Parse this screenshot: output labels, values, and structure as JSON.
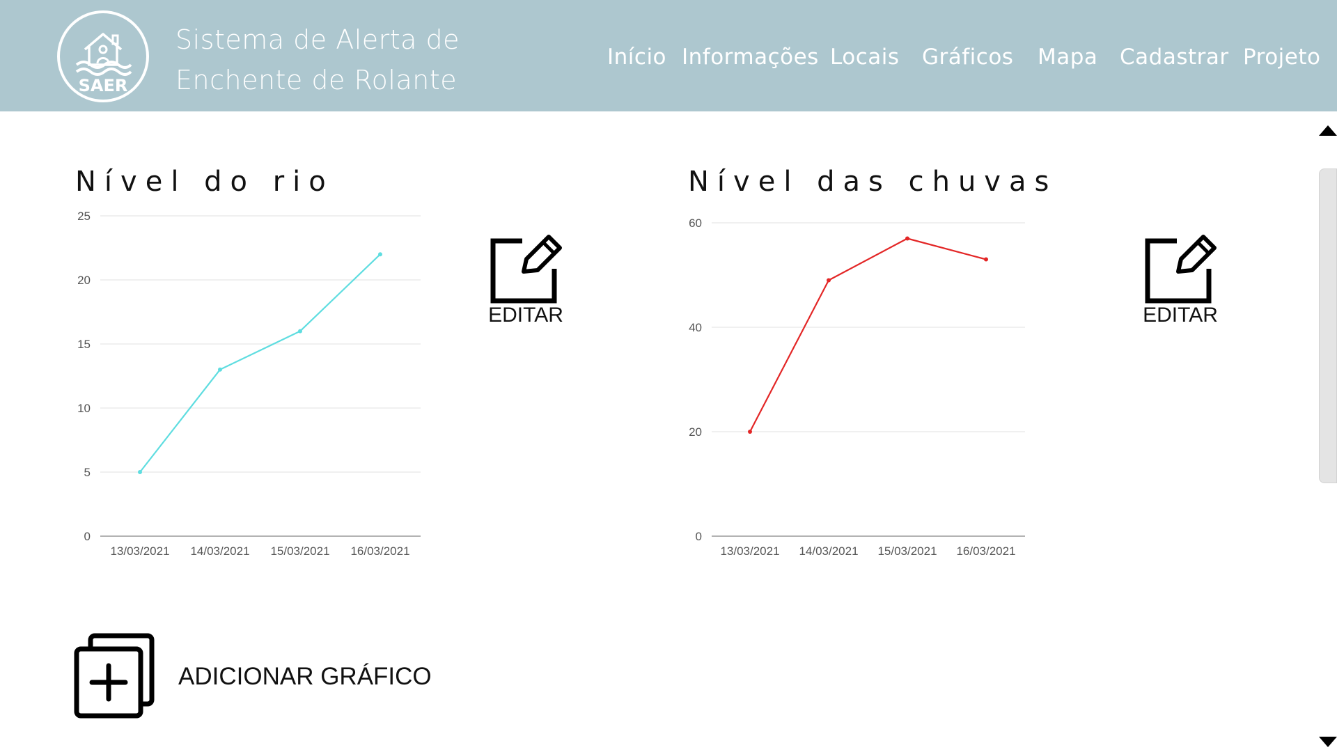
{
  "header": {
    "logo_text": "SAER",
    "title_line1": "Sistema de Alerta de",
    "title_line2": "Enchente de Rolante",
    "nav": [
      "Início",
      "Informações",
      "Locais",
      "Gráficos",
      "Mapa",
      "Cadastrar",
      "Projeto"
    ]
  },
  "charts_section": {
    "river": {
      "title": "Nível do rio",
      "edit_label": "EDITAR"
    },
    "rain": {
      "title": "Nível das chuvas",
      "edit_label": "EDITAR"
    }
  },
  "add_chart": {
    "label": "ADICIONAR GRÁFICO"
  },
  "icons": {
    "logo": "house-waves-logo",
    "edit": "edit-pencil-square-icon",
    "add": "add-copy-plus-icon",
    "scroll_up": "triangle-up-icon",
    "scroll_down": "triangle-down-icon"
  },
  "chart_data": [
    {
      "type": "line",
      "title": "Nível do rio",
      "categories": [
        "13/03/2021",
        "14/03/2021",
        "15/03/2021",
        "16/03/2021"
      ],
      "values": [
        5,
        13,
        16,
        22
      ],
      "ylim": [
        0,
        25
      ],
      "yticks": [
        0,
        5,
        10,
        15,
        20,
        25
      ],
      "grid": true,
      "color": "#5fdde0"
    },
    {
      "type": "line",
      "title": "Nível das chuvas",
      "categories": [
        "13/03/2021",
        "14/03/2021",
        "15/03/2021",
        "16/03/2021"
      ],
      "values": [
        20,
        49,
        57,
        53
      ],
      "ylim": [
        0,
        60
      ],
      "yticks": [
        0,
        20,
        40,
        60
      ],
      "grid": true,
      "color": "#e32626"
    }
  ]
}
